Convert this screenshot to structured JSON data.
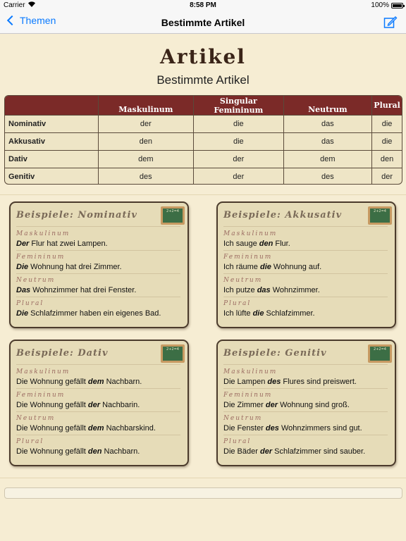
{
  "status_bar": {
    "carrier": "Carrier",
    "time": "8:58 PM",
    "battery": "100%"
  },
  "nav": {
    "back_label": "Themen",
    "title": "Bestimmte Artikel",
    "compose_icon": "compose-icon"
  },
  "header": {
    "title": "Artikel",
    "subtitle": "Bestimmte Artikel"
  },
  "table": {
    "singular_label": "Singular",
    "columns": [
      "Maskulinum",
      "Femininum",
      "Neutrum",
      "Plural"
    ],
    "rows": [
      {
        "case": "Nominativ",
        "values": [
          "der",
          "die",
          "das",
          "die"
        ]
      },
      {
        "case": "Akkusativ",
        "values": [
          "den",
          "die",
          "das",
          "die"
        ]
      },
      {
        "case": "Dativ",
        "values": [
          "dem",
          "der",
          "dem",
          "den"
        ]
      },
      {
        "case": "Genitiv",
        "values": [
          "des",
          "der",
          "des",
          "der"
        ]
      }
    ]
  },
  "cards": [
    {
      "title": "Beispiele: Nominativ",
      "board_text": "2+2=4",
      "examples": [
        {
          "label": "Maskulinum",
          "pre": "",
          "article": "Der",
          "post": " Flur hat zwei Lampen."
        },
        {
          "label": "Femininum",
          "pre": "",
          "article": "Die",
          "post": " Wohnung hat drei Zimmer."
        },
        {
          "label": "Neutrum",
          "pre": "",
          "article": "Das",
          "post": " Wohnzimmer hat drei Fenster."
        },
        {
          "label": "Plural",
          "pre": "",
          "article": "Die",
          "post": " Schlafzimmer haben ein eigenes Bad."
        }
      ]
    },
    {
      "title": "Beispiele: Akkusativ",
      "board_text": "2+2=4",
      "examples": [
        {
          "label": "Maskulinum",
          "pre": "Ich sauge ",
          "article": "den",
          "post": " Flur."
        },
        {
          "label": "Femininum",
          "pre": "Ich räume ",
          "article": "die",
          "post": " Wohnung auf."
        },
        {
          "label": "Neutrum",
          "pre": "Ich putze ",
          "article": "das",
          "post": " Wohnzimmer."
        },
        {
          "label": "Plural",
          "pre": "Ich lüfte ",
          "article": "die",
          "post": " Schlafzimmer."
        }
      ]
    },
    {
      "title": "Beispiele: Dativ",
      "board_text": "2+2=4",
      "examples": [
        {
          "label": "Maskulinum",
          "pre": "Die Wohnung gefällt ",
          "article": "dem",
          "post": " Nachbarn."
        },
        {
          "label": "Femininum",
          "pre": "Die Wohnung gefällt ",
          "article": "der",
          "post": " Nachbarin."
        },
        {
          "label": "Neutrum",
          "pre": "Die Wohnung gefällt ",
          "article": "dem",
          "post": " Nachbarskind."
        },
        {
          "label": "Plural",
          "pre": "Die Wohnung gefällt ",
          "article": "den",
          "post": " Nachbarn."
        }
      ]
    },
    {
      "title": "Beispiele: Genitiv",
      "board_text": "2+2=4",
      "examples": [
        {
          "label": "Maskulinum",
          "pre": "Die Lampen ",
          "article": "des",
          "post": " Flures sind preiswert."
        },
        {
          "label": "Femininum",
          "pre": "Die Zimmer ",
          "article": "der",
          "post": " Wohnung sind groß."
        },
        {
          "label": "Neutrum",
          "pre": "Die Fenster ",
          "article": "des",
          "post": " Wohnzimmers sind gut."
        },
        {
          "label": "Plural",
          "pre": "Die Bäder ",
          "article": "der",
          "post": " Schlafzimmer sind sauber."
        }
      ]
    }
  ],
  "colors": {
    "accent": "#0a7aff",
    "table_header": "#7b2a28",
    "background": "#f6edd3"
  }
}
